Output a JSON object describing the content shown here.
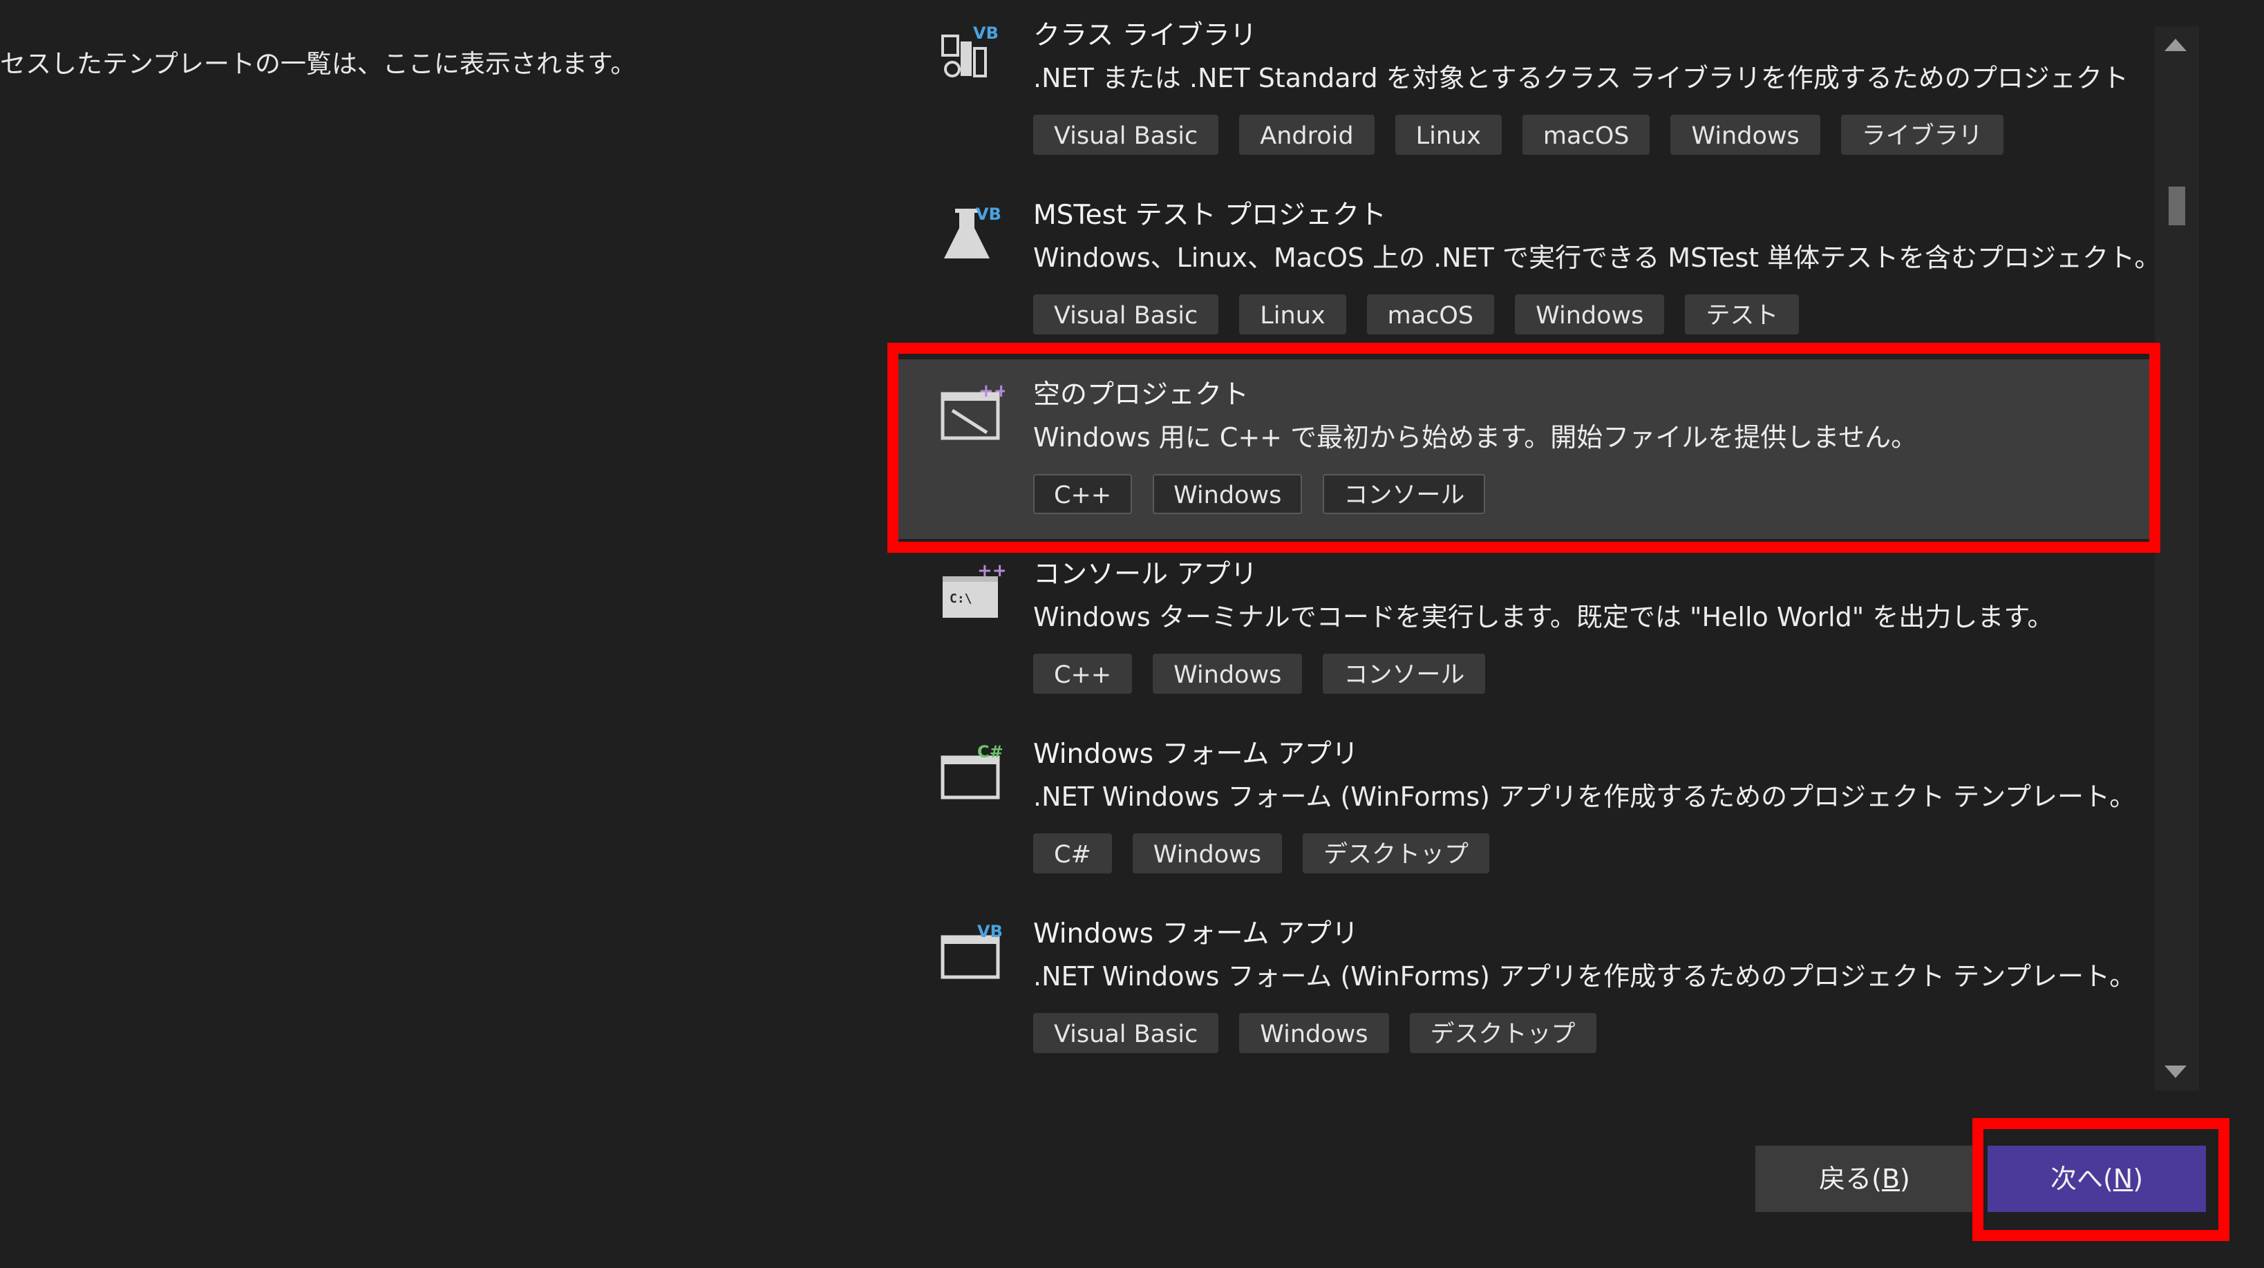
{
  "left_panel": {
    "recent_note": "セスしたテンプレートの一覧は、ここに表示されます。"
  },
  "templates": [
    {
      "icon": "vb-class-library-icon",
      "title": "クラス ライブラリ",
      "description": ".NET または .NET Standard を対象とするクラス ライブラリを作成するためのプロジェクト",
      "tags": [
        "Visual Basic",
        "Android",
        "Linux",
        "macOS",
        "Windows",
        "ライブラリ"
      ],
      "selected": false
    },
    {
      "icon": "vb-mstest-flask-icon",
      "title": "MSTest テスト プロジェクト",
      "description": "Windows、Linux、MacOS 上の .NET で実行できる MSTest 単体テストを含むプロジェクト。",
      "tags": [
        "Visual Basic",
        "Linux",
        "macOS",
        "Windows",
        "テスト"
      ],
      "selected": false
    },
    {
      "icon": "cpp-empty-project-icon",
      "title": "空のプロジェクト",
      "description": "Windows 用に C++ で最初から始めます。開始ファイルを提供しません。",
      "tags": [
        "C++",
        "Windows",
        "コンソール"
      ],
      "selected": true
    },
    {
      "icon": "cpp-console-app-icon",
      "title": "コンソール アプリ",
      "description": "Windows ターミナルでコードを実行します。既定では \"Hello World\" を出力します。",
      "tags": [
        "C++",
        "Windows",
        "コンソール"
      ],
      "selected": false
    },
    {
      "icon": "csharp-winforms-icon",
      "title": "Windows フォーム アプリ",
      "description": ".NET Windows フォーム (WinForms) アプリを作成するためのプロジェクト テンプレート。",
      "tags": [
        "C#",
        "Windows",
        "デスクトップ"
      ],
      "selected": false
    },
    {
      "icon": "vb-winforms-icon",
      "title": "Windows フォーム アプリ",
      "description": ".NET Windows フォーム (WinForms) アプリを作成するためのプロジェクト テンプレート。",
      "tags": [
        "Visual Basic",
        "Windows",
        "デスクトップ"
      ],
      "selected": false
    }
  ],
  "footer": {
    "back_label": "戻る(",
    "back_key": "B",
    "next_label": "次へ(",
    "next_key": "N",
    "close_paren": ")"
  },
  "colors": {
    "background": "#1f1f1f",
    "selected_row": "#3d3d3d",
    "tag_bg": "#3a3a3a",
    "next_button": "#4b3a9a",
    "back_button": "#3c3c3c",
    "highlight": "#ff0000",
    "vb_badge": "#4aa3df",
    "cpp_badge": "#b48ad6",
    "cs_badge": "#6ec26e"
  }
}
